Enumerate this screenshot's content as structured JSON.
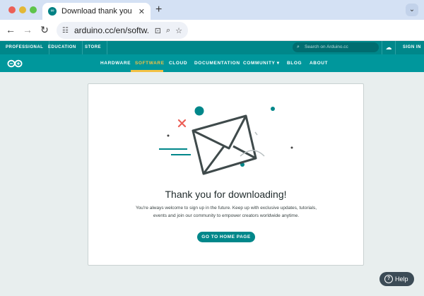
{
  "browser": {
    "tab_title": "Download thank you | Arduino",
    "tab_close": "✕",
    "new_tab": "+",
    "tab_menu": "⌄",
    "url": "arduino.cc/en/softw...",
    "nav": {
      "back": "←",
      "forward": "→",
      "reload": "↻"
    },
    "icons": {
      "tune": "☷",
      "install": "⊡",
      "zoom": "⌕",
      "bookmark": "☆"
    }
  },
  "topbar": {
    "links": [
      "PROFESSIONAL",
      "EDUCATION",
      "STORE"
    ],
    "search_placeholder": "Search on Arduino.cc",
    "sign_in": "SIGN IN"
  },
  "mainnav": {
    "items": [
      "HARDWARE",
      "SOFTWARE",
      "CLOUD",
      "DOCUMENTATION",
      "COMMUNITY ▾",
      "BLOG",
      "ABOUT"
    ],
    "active": "SOFTWARE"
  },
  "content": {
    "heading": "Thank you for downloading!",
    "subtext_line1": "You're always welcome to sign up in the future. Keep up with exclusive updates, tutorials,",
    "subtext_line2": "events and join our community to empower creators worldwide anytime.",
    "cta": "GO TO HOME PAGE"
  },
  "help": {
    "label": "Help",
    "icon": "?"
  },
  "colors": {
    "brand_teal": "#00979c",
    "topbar_teal": "#00878a",
    "active_yellow": "#f3c144",
    "accent_red": "#ec5f57"
  }
}
